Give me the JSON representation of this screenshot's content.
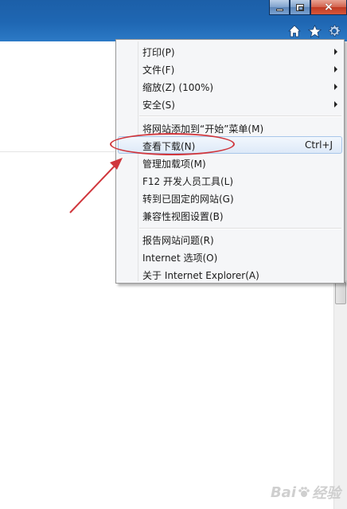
{
  "window": {
    "close_glyph": "×"
  },
  "toolbar": {
    "icons": [
      "home-icon",
      "favorites-star-icon",
      "tools-gear-icon"
    ]
  },
  "menu": {
    "items": [
      {
        "label": "打印(P)",
        "submenu": true
      },
      {
        "label": "文件(F)",
        "submenu": true
      },
      {
        "label": "缩放(Z) (100%)",
        "submenu": true
      },
      {
        "label": "安全(S)",
        "submenu": true
      },
      {
        "label": "将网站添加到“开始”菜单(M)",
        "submenu": false
      },
      {
        "label": "查看下载(N)",
        "shortcut": "Ctrl+J",
        "highlighted": true
      },
      {
        "label": "管理加载项(M)",
        "submenu": false
      },
      {
        "label": "F12 开发人员工具(L)",
        "submenu": false
      },
      {
        "label": "转到已固定的网站(G)",
        "submenu": false
      },
      {
        "label": "兼容性视图设置(B)",
        "submenu": false
      },
      {
        "label": "报告网站问题(R)",
        "submenu": false
      },
      {
        "label": "Internet 选项(O)",
        "submenu": false
      },
      {
        "label": "关于 Internet Explorer(A)",
        "submenu": false
      }
    ]
  },
  "colors": {
    "titlebar": "#1f67b3",
    "annotation": "#d0363c",
    "highlight_border": "#a8c6ea"
  },
  "watermark": {
    "text": "Bai",
    "suffix": "经验"
  }
}
